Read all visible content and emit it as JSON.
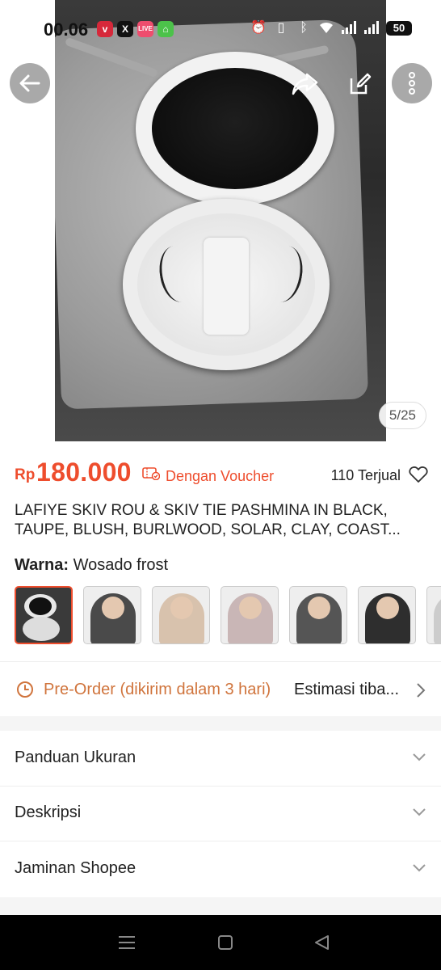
{
  "status_bar": {
    "time": "00.06",
    "battery": "50",
    "apps": [
      "vivo-icon",
      "x-icon",
      "shopee-live-icon",
      "chat-app-icon"
    ]
  },
  "gallery": {
    "counter": "5/25"
  },
  "product": {
    "currency": "Rp",
    "price": "180.000",
    "voucher_label": "Dengan Voucher",
    "sold": "110 Terjual",
    "title_line1": "LAFIYE SKIV ROU & SKIV TIE PASHMINA IN BLACK,",
    "title_line2": "TAUPE, BLUSH, BURLWOOD, SOLAR, CLAY, COAST..."
  },
  "variant": {
    "label": "Warna:",
    "selected": "Wosado frost"
  },
  "shipping": {
    "preorder": "Pre-Order (dikirim dalam 3 hari)",
    "estimate": "Estimasi tiba..."
  },
  "sections": [
    {
      "label": "Panduan Ukuran"
    },
    {
      "label": "Deskripsi"
    },
    {
      "label": "Jaminan Shopee"
    }
  ],
  "colors": {
    "accent": "#ee4d2d",
    "preorder": "#d0743c"
  }
}
